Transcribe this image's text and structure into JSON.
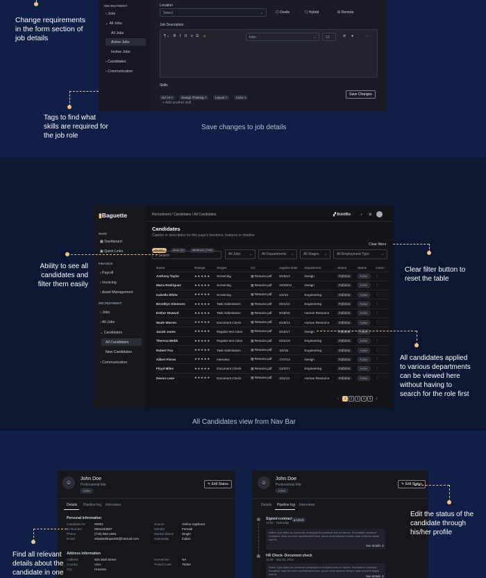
{
  "annotations": {
    "top_form": "Change requirements in the form section of job details",
    "skills_tags": "Tags to find what skills are required for the job role",
    "save_changes": "Save changes to job details",
    "filter_all": "Ability to see all candidates and filter them easily",
    "clear_filter": "Clear filter button to reset the table",
    "departments": "All candidates applied to various departments can be viewed here without having to search for the role first",
    "all_candidates_caption": "All Candidates view  from Nav Bar",
    "edit_status": "Edit the status of the candidate through his/her profile",
    "find_details": "Find all relevant details about the candidate in one"
  },
  "job_form": {
    "sidebar": {
      "section": "RECRUITMENT",
      "items": [
        "Jobs",
        "All Jobs",
        "Active Jobs",
        "Inctive Jobs",
        "Candidates",
        "Communication"
      ]
    },
    "location_label": "Location",
    "location_placeholder": "Select",
    "checks": [
      "Onsite",
      "Hybrid",
      "Remote"
    ],
    "description_label": "Job Description",
    "font_name": "Inter",
    "font_size": "13",
    "skills_label": "Skills",
    "skills": [
      "UX UI",
      "Design Thinking",
      "Layout",
      "Color"
    ],
    "add_skill": "+ Add another skill",
    "save_button": "Save Changes"
  },
  "candidates_app": {
    "logo": "Baguette",
    "breadcrumb": "Recruitment / Candidates / All Candidates",
    "company": "BuildBiz",
    "title": "Candidates",
    "caption": "Caption or description for this page's functions, features or timeline",
    "tabs": [
      "Weekly",
      "New (3)",
      "Platform (130)"
    ],
    "search_placeholder": "Search",
    "filters": [
      "All Jobs",
      "All Departments",
      "All Stages",
      "All Employment Type"
    ],
    "clear_filters": "Clear filters",
    "sidebar": {
      "main": "MAIN",
      "dashboard": "Dashboard",
      "quick_links": "Quick Links",
      "finance": "FINANCE",
      "finance_items": [
        "Payroll",
        "Invoicing",
        "Asset Management"
      ],
      "recruitment": "RECRUITMENT",
      "recruitment_items": [
        "Jobs",
        "All Jobs",
        "Candidates",
        "All Candidates",
        "New Candidates",
        "Communication"
      ]
    },
    "columns": [
      "Name",
      "Ratings",
      "Stages",
      "CV",
      "Applied Date",
      "Department",
      "Status",
      "Status",
      "Action"
    ],
    "rows": [
      {
        "name": "Anthony Taylor",
        "stars": "★★★★★",
        "stage": "Screening",
        "cv": "Resume.pdf",
        "date": "8/16/13",
        "dept": "Design",
        "s1": "Full time",
        "s2": "Active"
      },
      {
        "name": "Maria Rodriguez",
        "stars": "★★★★★",
        "stage": "Screening",
        "cv": "Resume.pdf",
        "date": "10/28/12",
        "dept": "Design",
        "s1": "Full time",
        "s2": "Active"
      },
      {
        "name": "Isabella White",
        "stars": "★★★★★",
        "stage": "Screening",
        "cv": "Resume.pdf",
        "date": "5/4/12",
        "dept": "Engineering",
        "s1": "Full time",
        "s2": "Active"
      },
      {
        "name": "Brooklyn Simmons",
        "stars": "★★★★★",
        "stage": "Task Submission",
        "cv": "Resume.pdf",
        "date": "8/21/15",
        "dept": "Engineering",
        "s1": "Full time",
        "s2": "Active"
      },
      {
        "name": "Esther Howard",
        "stars": "★★★★★",
        "stage": "Task Submission",
        "cv": "Resume.pdf",
        "date": "9/18/16",
        "dept": "Human Resource",
        "s1": "Full time",
        "s2": "Active"
      },
      {
        "name": "Wade Warren",
        "stars": "★★★★★",
        "stage": "Document Check",
        "cv": "Resume.pdf",
        "date": "6/19/14",
        "dept": "Human Resource",
        "s1": "Full time",
        "s2": "Active"
      },
      {
        "name": "Jacob Jones",
        "stars": "★★★★★",
        "stage": "Regular test colun",
        "cv": "Resume.pdf",
        "date": "8/15/17",
        "dept": "Design",
        "s1": "Full time",
        "s2": "Active"
      },
      {
        "name": "Theresa Webb",
        "stars": "★★★★★",
        "stage": "Regular test colun",
        "cv": "Resume.pdf",
        "date": "6/21/19",
        "dept": "Engineering",
        "s1": "Full time",
        "s2": "Active"
      },
      {
        "name": "Robert Fox",
        "stars": "★★★★★",
        "stage": "Task Submission",
        "cv": "Resume.pdf",
        "date": "3/4/16",
        "dept": "Engineering",
        "s1": "Full time",
        "s2": "Active"
      },
      {
        "name": "Albert Flores",
        "stars": "★★★★★",
        "stage": "Interview",
        "cv": "Resume.pdf",
        "date": "7/27/13",
        "dept": "Design",
        "s1": "Full time",
        "s2": "Active"
      },
      {
        "name": "Floyd Miles",
        "stars": "★★★★★",
        "stage": "Document Check",
        "cv": "Resume.pdf",
        "date": "12/4/17",
        "dept": "Engineering",
        "s1": "Full time",
        "s2": "Active"
      },
      {
        "name": "Devon Lane",
        "stars": "★★★★★",
        "stage": "Document Check",
        "cv": "Resume.pdf",
        "date": "2/11/12",
        "dept": "Human Resource",
        "s1": "Full time",
        "s2": "Active"
      }
    ],
    "pages": [
      "1",
      "2",
      "3",
      "4",
      "5"
    ]
  },
  "profile_left": {
    "name": "John Doe",
    "title": "Professional title",
    "badge": "Active",
    "edit": "Edit Status",
    "tabs": [
      "Details",
      "Pipeline log",
      "Interviews"
    ],
    "personal_head": "Personal information",
    "personal": [
      [
        "Candidate ID",
        "#0001"
      ],
      [
        "ID Number",
        "0001234567"
      ],
      [
        "Phone",
        "(718) 862-1684"
      ],
      [
        "Email",
        "elizabethlopez09@hotmail.com"
      ]
    ],
    "personal2": [
      [
        "Source",
        "Online Applicant"
      ],
      [
        "Gender",
        "Female"
      ],
      [
        "Marital Status",
        "Single"
      ],
      [
        "Nationality",
        "Indian"
      ]
    ],
    "address_head": "Address information",
    "address": [
      [
        "Address",
        "925 Wall Street"
      ],
      [
        "Country",
        "USA"
      ],
      [
        "City",
        "Houston"
      ]
    ],
    "address2": [
      [
        "Hometown",
        "NA"
      ],
      [
        "Postal Code",
        "75254"
      ]
    ]
  },
  "profile_right": {
    "name": "John Doe",
    "title": "Professional title",
    "badge": "Active",
    "edit": "Edit Status",
    "tabs": [
      "Details",
      "Pipeline log",
      "Interviews"
    ],
    "log1_title": "Signed contract",
    "log1_time": "11:00 - Yesterday",
    "log1_badge": "● Hired",
    "log1_text": "Notes: Quis tiliam ac commodo consequat id incididunt duis ex laboris. Exercitation deserunt excepteur esse est enim reprehenderit esse. Ipsum amet laborum tempor esse tincidunt aliqua sunt id.",
    "see_details": "See details",
    "log2_title": "HR Check- Document check",
    "log2_time": "11:00 - Sep 26, 2023",
    "log2_text": "Notes: Quis tiliam ac commodo consequat id incididunt duis ex laboris. Exercitation deserunt excepteur esse est enim reprehenderit esse. Ipsum amet laborum tempor esse tincidunt aliqua sunt id."
  }
}
